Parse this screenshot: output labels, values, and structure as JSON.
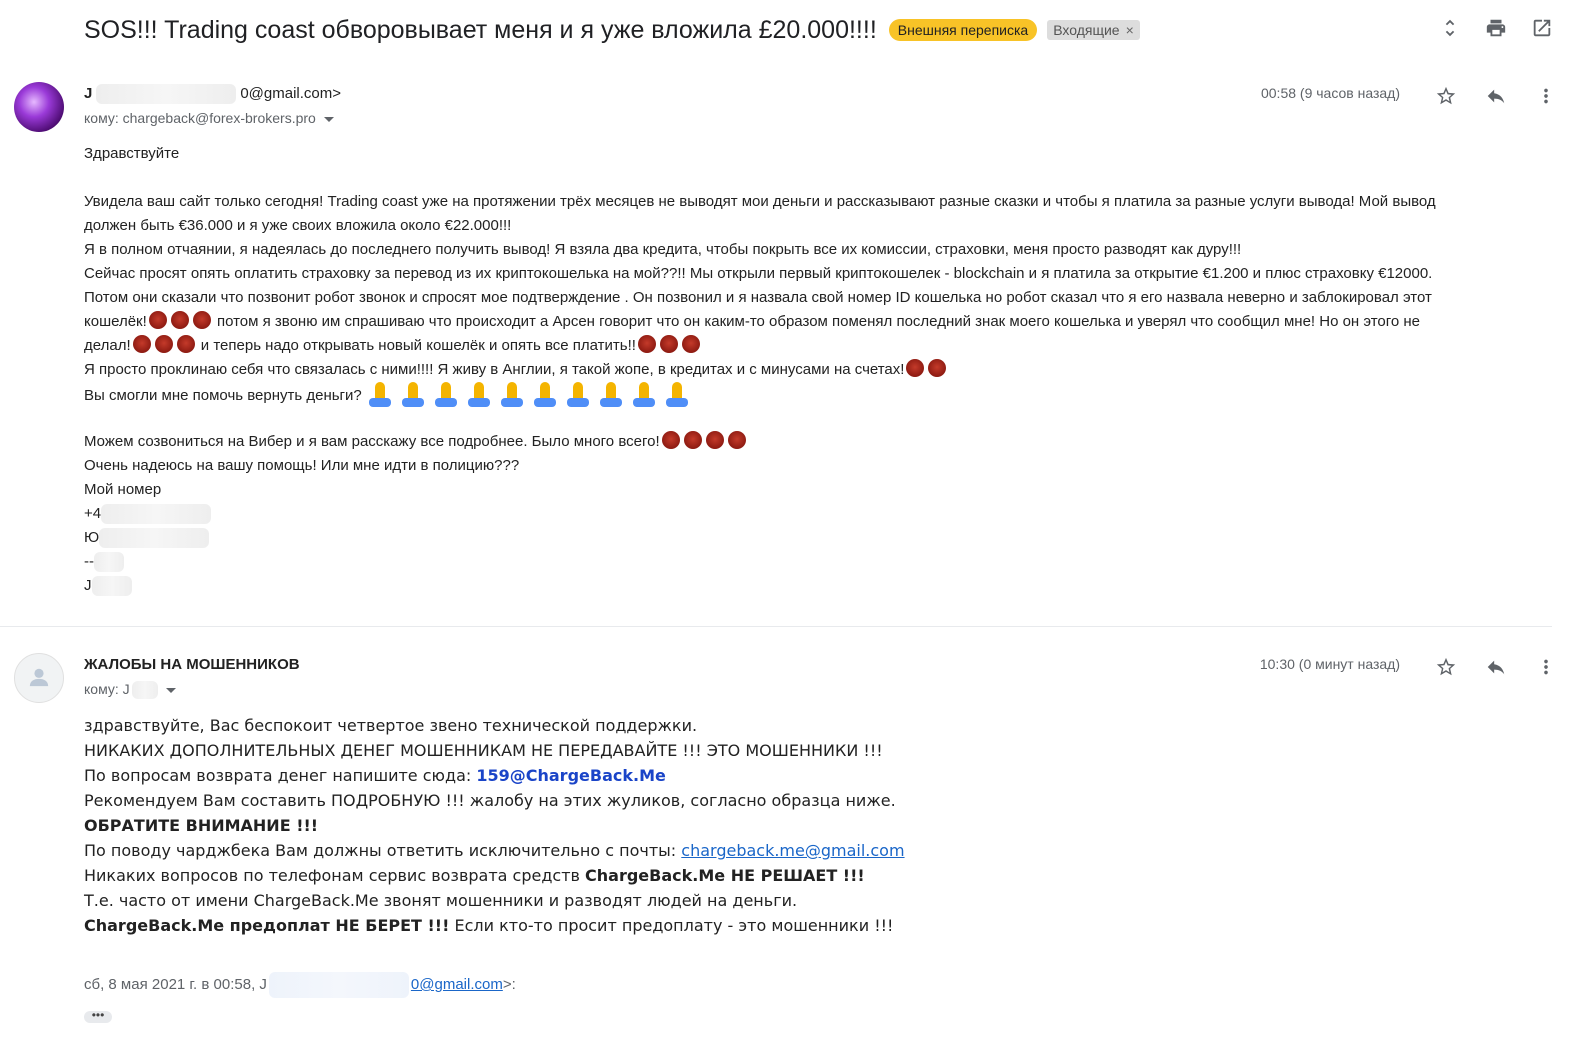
{
  "subject": "SOS!!! Trading coast обворовывает меня и я уже вложила £20.000!!!!",
  "labels": {
    "external": "Внешняя переписка",
    "inbox": "Входящие",
    "inbox_close": "×"
  },
  "message1": {
    "sender_initial": "J",
    "sender_email_suffix": "0@gmail.com>",
    "to": "кому: chargeback@forex-brokers.pro",
    "time": "00:58 (9 часов назад)",
    "greeting": "Здравствуйте",
    "lines": [
      "Увидела ваш сайт только сегодня! Trading coast  уже на протяжении трёх месяцев не выводят мои деньги и рассказывают разные сказки и чтобы я платила за разные услуги вывода! Мой вывод",
      "должен быть €36.000 и я уже своих вложила около €22.000!!!",
      "Я в полном отчаянии, я надеялась до последнего получить вывод! Я взяла два кредита, чтобы покрыть все их комиссии, страховки, меня просто разводят как дуру!!!",
      "Сейчас просят опять оплатить страховку за перевод из их криптокошелька на мой??!! Мы открыли первый криптокошелек - blockchain и я платила за открытие €1.200 и плюс страховку €12000.",
      "Потом они сказали что позвонит робот звонок и спросят мое подтверждение . Он позвонил и я назвала свой номер ID кошелька но робот сказал что я его назвала неверно и заблокировал этот",
      "кошелёк!",
      " потом я звоню им спрашиваю что происходит а Арсен говорит  что он каким-то образом поменял последний знак моего кошелька и уверял что сообщил мне! Но он этого не",
      "делал!",
      " и теперь надо открывать новый кошелёк и опять все платить!!",
      "Я просто проклинаю себя что связалась с ними!!!! Я живу в Англии, я такой жопе, в кредитах и с минусами на счетах!",
      "Вы смогли мне помочь вернуть деньги? ",
      "Можем созвониться на Вибер и я вам расскажу все подробнее. Было много всего!",
      "Очень надеюсь на вашу помощь! Или мне идти в полицию???",
      "Мой номер",
      "+4",
      "Ю",
      "--",
      "J"
    ]
  },
  "message2": {
    "sender": "ЖАЛОБЫ НА МОШЕННИКОВ",
    "to": "кому: J",
    "time": "10:30 (0 минут назад)",
    "l1": "здравствуйте, Вас беспокоит четвертое звено технической поддержки.",
    "l2": "НИКАКИХ ДОПОЛНИТЕЛЬНЫХ ДЕНЕГ МОШЕННИКАМ НЕ ПЕРЕДАВАЙТЕ !!! ЭТО МОШЕННИКИ !!!",
    "l3_text": "По вопросам возврата денег напишите сюда: ",
    "l3_link": "159@ChargeBack.Me",
    "l4": "Рекомендуем Вам составить ПОДРОБНУЮ !!! жалобу на этих жуликов, согласно образца ниже.",
    "l5": "ОБРАТИТЕ ВНИМАНИЕ !!!",
    "l6_text": "По поводу чарджбека Вам должны ответить исключительно с почты: ",
    "l6_link": "chargeback.me@gmail.com",
    "l7_text": "Никаких вопросов по телефонам сервис возврата средств ",
    "l7_bold": "ChargeBack.Me НЕ РЕШАЕТ !!!",
    "l8": "Т.е. часто от имени ChargeBack.Me звонят мошенники и разводят людей на деньги.",
    "l9_bold": "ChargeBack.Me предоплат НЕ БЕРЕТ !!!",
    "l9_text": " Если кто-то просит предоплату - это мошенники !!!",
    "quote_prefix": "сб, 8 мая 2021 г. в 00:58, J",
    "quote_link": "0@gmail.com",
    "quote_suffix": ">:",
    "ellipsis": "•••"
  }
}
